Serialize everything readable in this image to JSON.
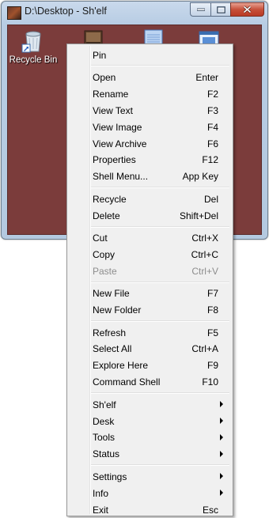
{
  "window": {
    "title": "D:\\Desktop - Sh'elf",
    "client_color": "#7b3c3b"
  },
  "desktop_icons": [
    {
      "label": "Recycle Bin",
      "icon": "recycle-bin-icon"
    },
    {
      "label": "",
      "icon": "folder-image-icon"
    },
    {
      "label": "",
      "icon": "text-document-icon"
    },
    {
      "label": "",
      "icon": "shortcut-window-icon"
    }
  ],
  "menu": {
    "groups": [
      [
        {
          "label": "Pin",
          "shortcut": ""
        }
      ],
      [
        {
          "label": "Open",
          "shortcut": "Enter"
        },
        {
          "label": "Rename",
          "shortcut": "F2"
        },
        {
          "label": "View Text",
          "shortcut": "F3"
        },
        {
          "label": "View Image",
          "shortcut": "F4"
        },
        {
          "label": "View Archive",
          "shortcut": "F6"
        },
        {
          "label": "Properties",
          "shortcut": "F12"
        },
        {
          "label": "Shell Menu...",
          "shortcut": "App Key"
        }
      ],
      [
        {
          "label": "Recycle",
          "shortcut": "Del"
        },
        {
          "label": "Delete",
          "shortcut": "Shift+Del"
        }
      ],
      [
        {
          "label": "Cut",
          "shortcut": "Ctrl+X"
        },
        {
          "label": "Copy",
          "shortcut": "Ctrl+C"
        },
        {
          "label": "Paste",
          "shortcut": "Ctrl+V",
          "disabled": true
        }
      ],
      [
        {
          "label": "New File",
          "shortcut": "F7"
        },
        {
          "label": "New Folder",
          "shortcut": "F8"
        }
      ],
      [
        {
          "label": "Refresh",
          "shortcut": "F5"
        },
        {
          "label": "Select All",
          "shortcut": "Ctrl+A"
        },
        {
          "label": "Explore Here",
          "shortcut": "F9"
        },
        {
          "label": "Command Shell",
          "shortcut": "F10"
        }
      ],
      [
        {
          "label": "Sh'elf",
          "submenu": true
        },
        {
          "label": "Desk",
          "submenu": true
        },
        {
          "label": "Tools",
          "submenu": true
        },
        {
          "label": "Status",
          "submenu": true
        }
      ],
      [
        {
          "label": "Settings",
          "submenu": true
        },
        {
          "label": "Info",
          "submenu": true
        },
        {
          "label": "Exit",
          "shortcut": "Esc"
        }
      ]
    ]
  }
}
